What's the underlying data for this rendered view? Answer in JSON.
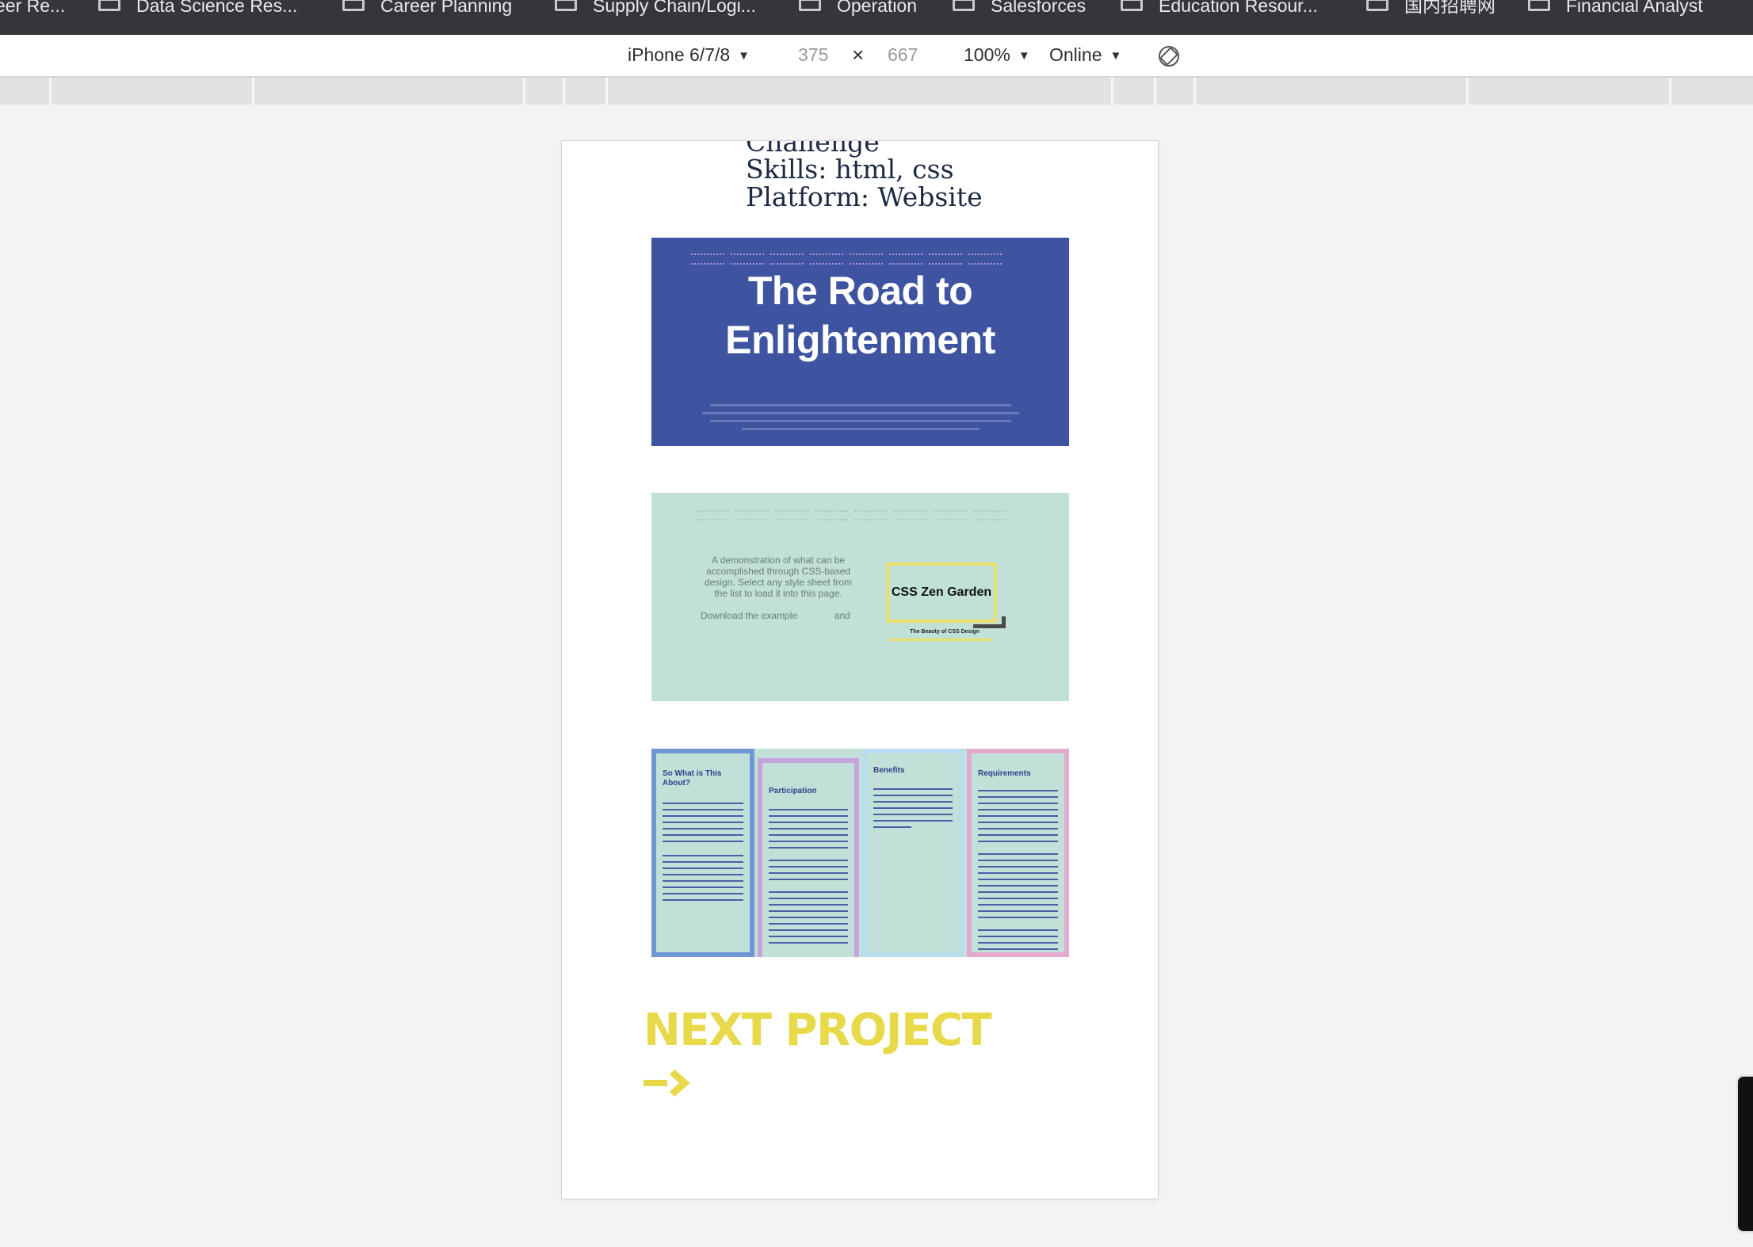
{
  "bookmarks": [
    {
      "label": "eer Re..."
    },
    {
      "label": "Data Science Res..."
    },
    {
      "label": "Career Planning"
    },
    {
      "label": "Supply Chain/Logi..."
    },
    {
      "label": "Operation"
    },
    {
      "label": "Salesforces"
    },
    {
      "label": "Education Resour..."
    },
    {
      "label": "国内招聘网"
    },
    {
      "label": "Financial Analyst"
    }
  ],
  "device_toolbar": {
    "device": "iPhone 6/7/8",
    "width": "375",
    "times": "×",
    "height": "667",
    "zoom": "100%",
    "network": "Online"
  },
  "page": {
    "partial_title": "Challenge",
    "skills": "Skills: html, css",
    "platform": "Platform: Website",
    "shot1": {
      "heading_line1": "The Road to",
      "heading_line2": "Enlightenment"
    },
    "shot2": {
      "intro": "A demonstration of what can be accomplished through CSS-based design. Select any style sheet from the list to load it into this page.",
      "download": "Download the example",
      "download_and": "and",
      "zen_title": "CSS Zen Garden",
      "tagline": "The Beauty of CSS Design"
    },
    "shot3": {
      "columns": [
        {
          "heading": "So What is This About?"
        },
        {
          "heading": "Participation"
        },
        {
          "heading": "Benefits"
        },
        {
          "heading": "Requirements"
        }
      ]
    },
    "next_project": "NEXT PROJECT",
    "next_arrow": "–›"
  },
  "colors": {
    "accent_yellow": "#e8d94a",
    "zen_blue": "#3e54a1",
    "zen_mint": "#c1e1d8",
    "text_navy": "#1d2a44"
  }
}
